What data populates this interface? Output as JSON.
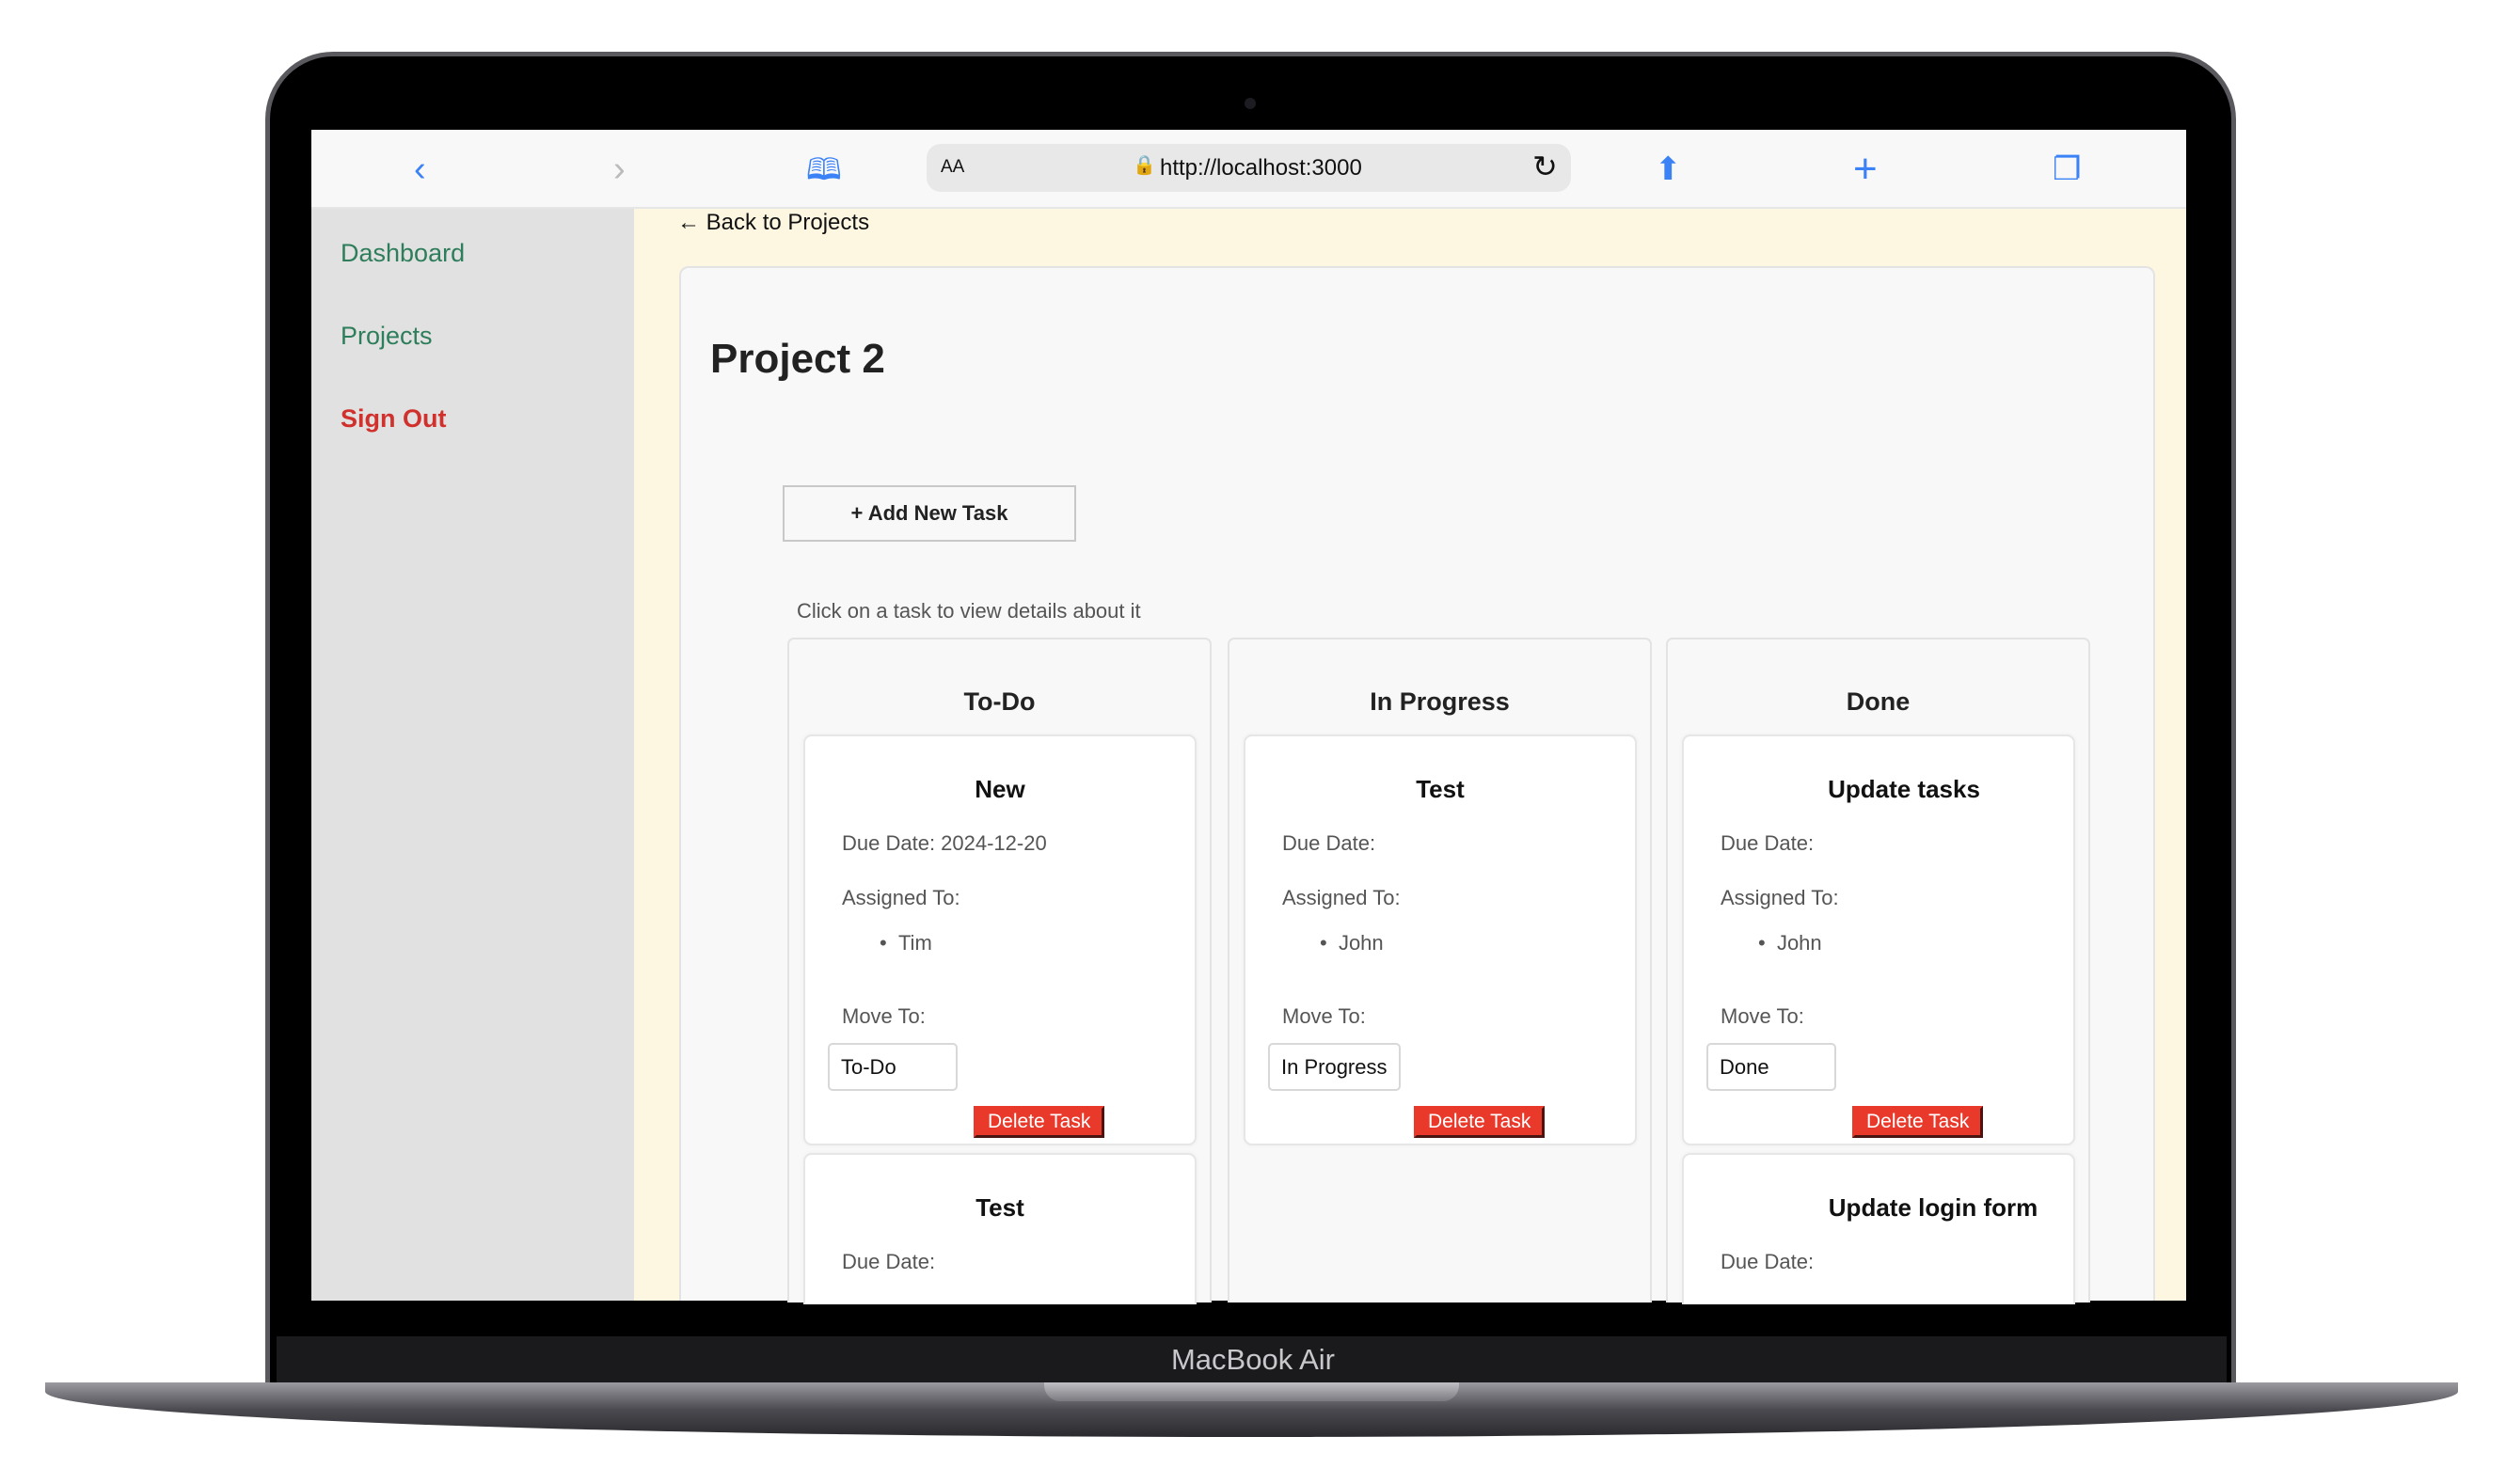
{
  "device": {
    "brand": "MacBook Air"
  },
  "browser": {
    "url": "http://localhost:3000",
    "text_size_label": "AA",
    "icons": [
      "back-icon",
      "forward-icon",
      "bookmarks-icon",
      "lock-icon",
      "reload-icon",
      "share-icon",
      "new-tab-icon",
      "tabs-icon"
    ],
    "accent": "#3b82f6"
  },
  "sidebar": {
    "items": [
      {
        "label": "Dashboard"
      },
      {
        "label": "Projects"
      },
      {
        "label": "Sign Out"
      }
    ]
  },
  "main": {
    "back_label": "← Back to Projects",
    "title": "Project 2",
    "add_task_label": "+ Add New Task",
    "hint": "Click on a task to view details about it",
    "columns": [
      {
        "title": "To-Do",
        "tasks": [
          {
            "name": "New",
            "due": "Due Date: 2024-12-20",
            "assigned_label": "Assigned To:",
            "assignees": [
              "Tim"
            ],
            "move_label": "Move To:",
            "status": "To-Do",
            "delete_label": "Delete Task"
          },
          {
            "name": "Test",
            "due": "Due Date:"
          }
        ]
      },
      {
        "title": "In Progress",
        "tasks": [
          {
            "name": "Test",
            "due": "Due Date:",
            "assigned_label": "Assigned To:",
            "assignees": [
              "John"
            ],
            "move_label": "Move To:",
            "status": "In Progress",
            "delete_label": "Delete Task"
          }
        ]
      },
      {
        "title": "Done",
        "tasks": [
          {
            "name": "Update tasks",
            "due": "Due Date:",
            "assigned_label": "Assigned To:",
            "assignees": [
              "John"
            ],
            "move_label": "Move To:",
            "status": "Done",
            "delete_label": "Delete Task"
          },
          {
            "name": "Update login form",
            "due": "Due Date:"
          }
        ]
      }
    ]
  },
  "colors": {
    "link": "#2e7d5b",
    "signout": "#d0312d",
    "delete": "#e8392b",
    "background": "#fdf6e1"
  }
}
